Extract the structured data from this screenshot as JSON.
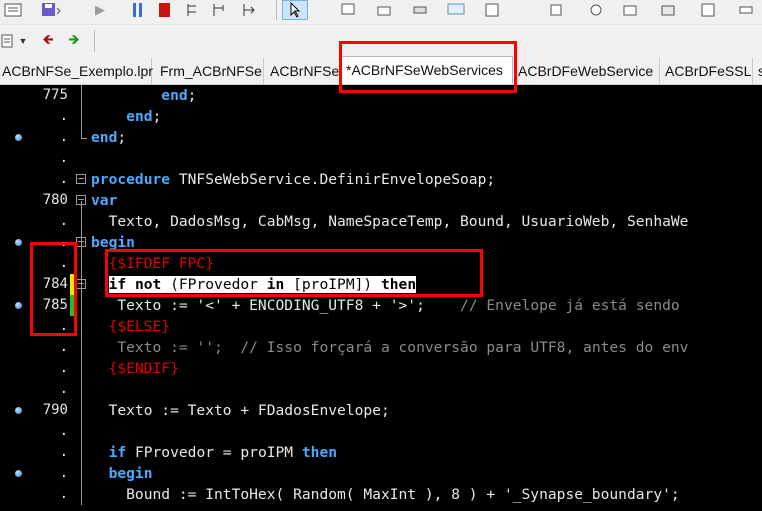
{
  "toolbar": {
    "icons": [
      "list-icon",
      "save-icon",
      "run-icon",
      "pause-icon",
      "stop-icon",
      "step-into-icon",
      "step-over-icon",
      "cursor-icon",
      "component-icon"
    ]
  },
  "tabs": [
    {
      "label": "ACBrNFSe_Exemplo.lpr",
      "active": false
    },
    {
      "label": "Frm_ACBrNFSe",
      "active": false
    },
    {
      "label": "ACBrNFSe",
      "active": false
    },
    {
      "label": "*ACBrNFSeWebServices",
      "active": true
    },
    {
      "label": "ACBrDFeWebService",
      "active": false
    },
    {
      "label": "ACBrDFeSSL",
      "active": false
    },
    {
      "label": "s",
      "active": false
    }
  ],
  "gutter": {
    "line_numbers": [
      "775",
      ".",
      ".",
      ".",
      ".",
      "780",
      ".",
      ".",
      ".",
      "784",
      "785",
      ".",
      ".",
      ".",
      ".",
      "790",
      ".",
      ".",
      ".",
      "."
    ]
  },
  "code": [
    [
      {
        "t": "        ",
        "c": "tx"
      },
      {
        "t": "end",
        "c": "kw"
      },
      {
        "t": ";",
        "c": "sy"
      }
    ],
    [
      {
        "t": "    ",
        "c": "tx"
      },
      {
        "t": "end",
        "c": "kw"
      },
      {
        "t": ";",
        "c": "sy"
      }
    ],
    [
      {
        "t": "end",
        "c": "kw"
      },
      {
        "t": ";",
        "c": "sy"
      }
    ],
    [],
    [
      {
        "t": "procedure",
        "c": "kw"
      },
      {
        "t": " TNFSeWebService.DefinirEnvelopeSoap;",
        "c": "tx"
      }
    ],
    [
      {
        "t": "var",
        "c": "kw"
      }
    ],
    [
      {
        "t": "  Texto, DadosMsg, CabMsg, NameSpaceTemp, Bound, UsuarioWeb, SenhaWe",
        "c": "tx"
      }
    ],
    [
      {
        "t": "begin",
        "c": "kw"
      }
    ],
    [
      {
        "t": "  {$IFDEF FPC}",
        "c": "dir"
      }
    ],
    [
      {
        "t": "  ",
        "c": "tx"
      },
      {
        "t": "if",
        "c": "kwb hl"
      },
      {
        "t": " ",
        "c": "hl"
      },
      {
        "t": "not",
        "c": "kwb hl"
      },
      {
        "t": " (FProvedor ",
        "c": "hl"
      },
      {
        "t": "in",
        "c": "kwb hl"
      },
      {
        "t": " [proIPM]) ",
        "c": "hl"
      },
      {
        "t": "then",
        "c": "kwb hl"
      }
    ],
    [
      {
        "t": "   Texto := '<' + ENCODING_UTF8 + '>';    ",
        "c": "tx"
      },
      {
        "t": "// Envelope já está sendo",
        "c": "cm"
      }
    ],
    [
      {
        "t": "  {$ELSE}",
        "c": "dir"
      }
    ],
    [
      {
        "t": "   Texto := '';  ",
        "c": "cm"
      },
      {
        "t": "// Isso forçará a conversão para UTF8, antes do env",
        "c": "cm"
      }
    ],
    [
      {
        "t": "  {$ENDIF}",
        "c": "dir"
      }
    ],
    [],
    [
      {
        "t": "  Texto := Texto + FDadosEnvelope;",
        "c": "tx"
      }
    ],
    [],
    [
      {
        "t": "  ",
        "c": "tx"
      },
      {
        "t": "if",
        "c": "kw"
      },
      {
        "t": " FProvedor = proIPM ",
        "c": "tx"
      },
      {
        "t": "then",
        "c": "kw"
      }
    ],
    [
      {
        "t": "  ",
        "c": "tx"
      },
      {
        "t": "begin",
        "c": "kw"
      }
    ],
    [
      {
        "t": "    Bound := IntToHex( Random( MaxInt ), 8 ) + '_Synapse_boundary';",
        "c": "tx"
      }
    ]
  ]
}
